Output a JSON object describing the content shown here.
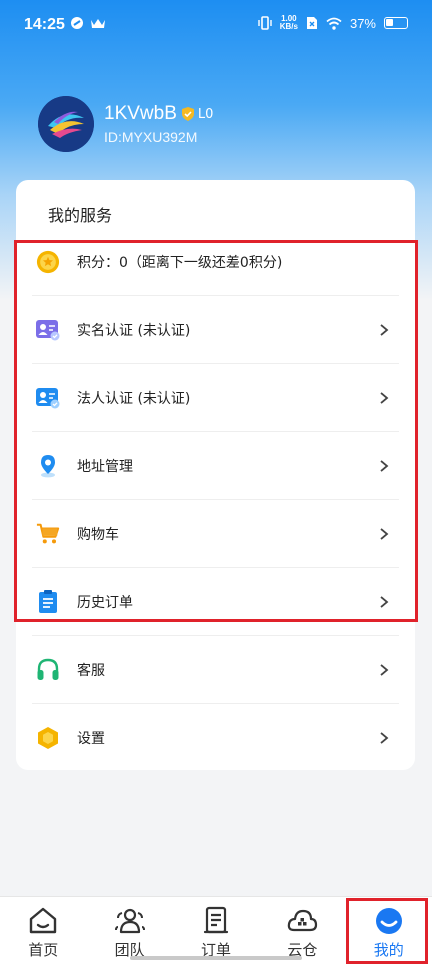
{
  "status_bar": {
    "time": "14:25",
    "speed_value": "1.00",
    "speed_unit": "KB/s",
    "battery": "37%"
  },
  "profile": {
    "username": "1KVwbB",
    "level": "L0",
    "user_id": "ID:MYXU392M"
  },
  "services": {
    "title": "我的服务",
    "items": [
      {
        "label": "积分：0（距离下一级还差0积分)",
        "icon": "coin-icon",
        "chevron": false
      },
      {
        "label": "实名认证 (未认证)",
        "icon": "id-card-icon",
        "chevron": true
      },
      {
        "label": "法人认证 (未认证)",
        "icon": "legal-card-icon",
        "chevron": true
      },
      {
        "label": "地址管理",
        "icon": "location-pin-icon",
        "chevron": true
      },
      {
        "label": "购物车",
        "icon": "shopping-cart-icon",
        "chevron": true
      },
      {
        "label": "历史订单",
        "icon": "clipboard-icon",
        "chevron": true
      },
      {
        "label": "客服",
        "icon": "headset-icon",
        "chevron": true
      },
      {
        "label": "设置",
        "icon": "settings-hexagon-icon",
        "chevron": true
      }
    ]
  },
  "tabs": [
    {
      "label": "首页",
      "icon": "home-icon",
      "active": false
    },
    {
      "label": "团队",
      "icon": "team-icon",
      "active": false
    },
    {
      "label": "订单",
      "icon": "order-scroll-icon",
      "active": false
    },
    {
      "label": "云仓",
      "icon": "cloud-warehouse-icon",
      "active": false
    },
    {
      "label": "我的",
      "icon": "profile-face-icon",
      "active": true
    }
  ],
  "colors": {
    "accent": "#1a78f2",
    "highlight": "#e0222b"
  }
}
